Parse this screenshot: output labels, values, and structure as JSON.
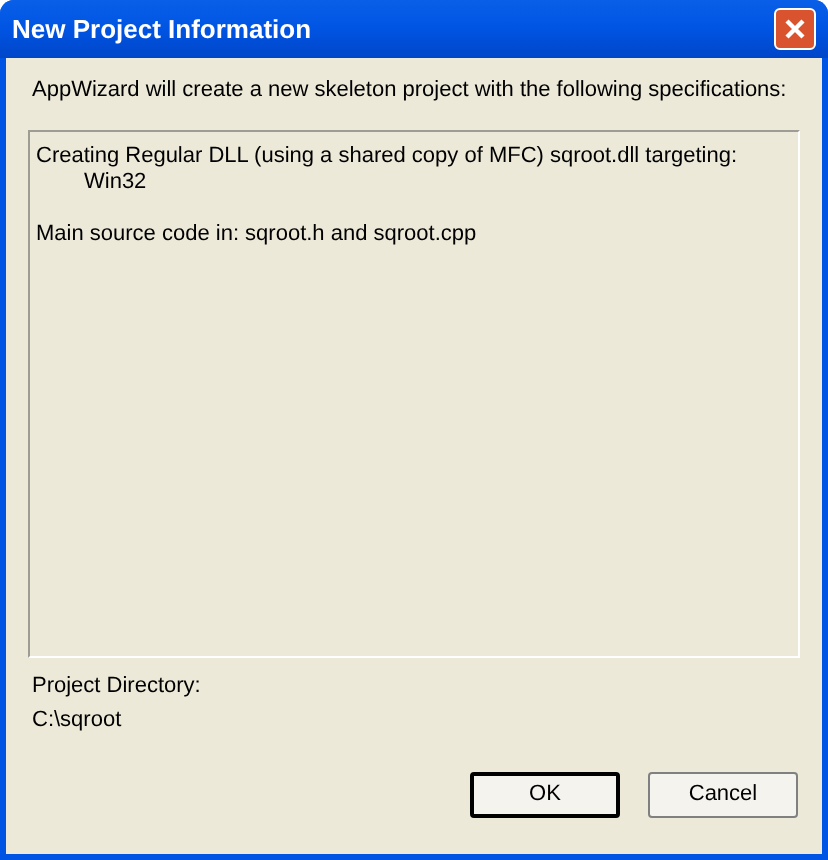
{
  "window": {
    "title": "New Project Information"
  },
  "intro": "AppWizard will create a new skeleton project with the following specifications:",
  "specifications": [
    {
      "lines": [
        {
          "text": "Creating Regular DLL (using a shared copy of MFC) sqroot.dll targeting:",
          "indented": false
        },
        {
          "text": "Win32",
          "indented": true
        }
      ]
    },
    {
      "lines": [
        {
          "text": "Main source code in: sqroot.h and sqroot.cpp",
          "indented": false
        }
      ]
    }
  ],
  "project_directory": {
    "label": "Project Directory:",
    "value": "C:\\sqroot"
  },
  "buttons": [
    {
      "label": "OK",
      "default": true
    },
    {
      "label": "Cancel",
      "default": false
    }
  ]
}
